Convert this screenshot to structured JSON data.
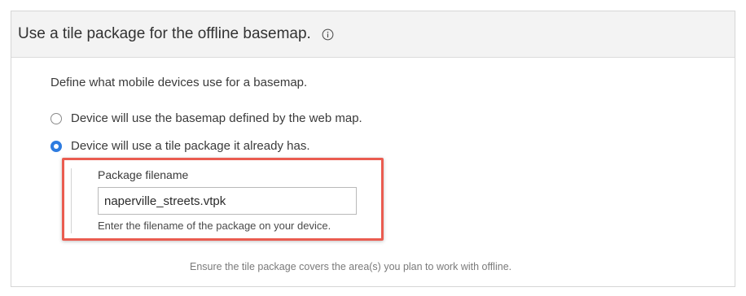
{
  "panel": {
    "title": "Use a tile package for the offline basemap.",
    "info_icon": "info-circle-icon",
    "description": "Define what mobile devices use for a basemap.",
    "options": [
      {
        "label": "Device will use the basemap defined by the web map.",
        "selected": false
      },
      {
        "label": "Device will use a tile package it already has.",
        "selected": true
      }
    ],
    "package_field": {
      "label": "Package filename",
      "value": "naperville_streets.vtpk",
      "help": "Enter the filename of the package on your device."
    },
    "footer_note": "Ensure the tile package covers the area(s) you plan to work with offline."
  },
  "colors": {
    "accent": "#2e7ce0",
    "highlight": "#ea5c50",
    "header_bg": "#f3f3f3"
  }
}
